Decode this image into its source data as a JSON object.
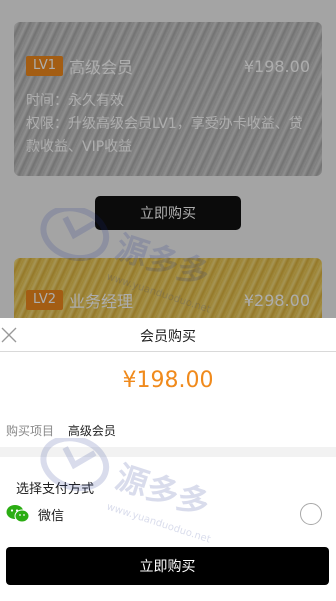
{
  "background": {
    "card1": {
      "badge": "LV1",
      "name": "高级会员",
      "price": "¥198.00",
      "time_line": "时间：永久有效",
      "perm_line": "权限：升级高级会员LV1，享受办卡收益、贷款收益、VIP收益"
    },
    "buy_button": "立即购买",
    "card2": {
      "badge": "LV2",
      "name": "业务经理",
      "price": "¥298.00"
    }
  },
  "sheet": {
    "title": "会员购买",
    "price": "¥198.00",
    "item_label": "购买项目",
    "item_value": "高级会员",
    "pay_title": "选择支付方式",
    "pay_method": "微信",
    "buy_button": "立即购买"
  },
  "watermark": {
    "text": "源多多",
    "url": "www.yuanduoduo.net"
  },
  "colors": {
    "accent": "#f08a1c",
    "button": "#000000",
    "wechat": "#2bad13"
  },
  "icons": [
    "close-icon",
    "wechat-icon",
    "radio-unchecked-icon",
    "watermark-logo-icon"
  ]
}
